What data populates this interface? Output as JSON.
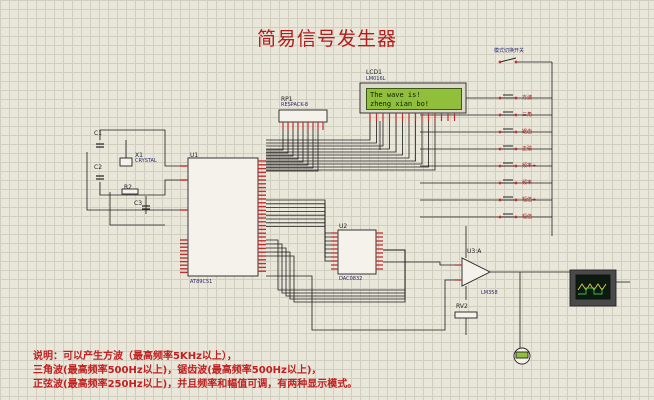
{
  "title": "简易信号发生器",
  "lcd": {
    "name": "LCD1",
    "model": "LM016L",
    "line1": "The wave is!",
    "line2": "zheng xian bo!"
  },
  "components": {
    "rp1": "RP1",
    "rp1_sub": "RESPACK-8",
    "c1": "C1",
    "c2": "C2",
    "c3": "C3",
    "x1": "X1",
    "x1_sub": "CRYSTAL",
    "r2": "R2",
    "u1": "U1",
    "u1_sub": "AT89C51",
    "u2": "U2",
    "u2_sub": "DAC0832",
    "u3": "U3:A",
    "u3_sub": "LM358",
    "rv2": "RV2",
    "switch_label": "模式切换开关"
  },
  "buttons": [
    "方波",
    "三角",
    "锯齿",
    "正弦",
    "频率+",
    "频率-",
    "幅值+",
    "幅值-"
  ],
  "description": {
    "line1": "说明：可以产生方波（最高频率5KHz以上），",
    "line2": "三角波(最高频率500Hz以上)，锯齿波(最高频率500Hz以上)，",
    "line3": "正弦波(最高频率250Hz以上)，并且频率和幅值可调，有两种显示模式。"
  },
  "colors": {
    "wire": "#1c1c1c",
    "pin_red": "#c03030",
    "pin_blue": "#2a2aa0",
    "title": "#b51c1c",
    "lcd_screen": "#8fbf3b"
  }
}
